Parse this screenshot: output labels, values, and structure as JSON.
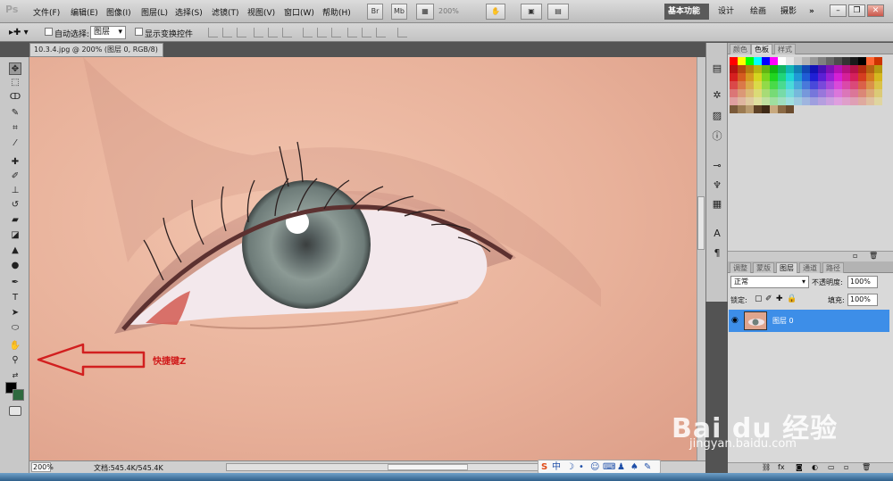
{
  "app": {
    "logo": "Ps"
  },
  "menu": [
    "文件(F)",
    "编辑(E)",
    "图像(I)",
    "图层(L)",
    "选择(S)",
    "滤镜(T)",
    "视图(V)",
    "窗口(W)",
    "帮助(H)"
  ],
  "menubar": {
    "bridge_btn": "Br",
    "minibridge_btn": "Mb",
    "zoom": "200%",
    "workspaces": [
      "基本功能",
      "设计",
      "绘画",
      "摄影"
    ],
    "more": "»"
  },
  "options": {
    "auto_select_label": "自动选择:",
    "auto_select_target": "图层",
    "show_transform_label": "显示变换控件"
  },
  "document": {
    "tab_title": "10.3.4.jpg @ 200% (图层 0, RGB/8) *",
    "status_zoom": "200%",
    "status_doc": "文档:545.4K/545.4K"
  },
  "annotation": {
    "text": "快捷键Z",
    "color": "#d01a1a"
  },
  "swatches_panel": {
    "tabs": [
      "颜色",
      "色板",
      "样式"
    ],
    "active": 1
  },
  "layers_panel": {
    "tabs": [
      "调整",
      "蒙版",
      "图层",
      "通道",
      "路径"
    ],
    "active": 2,
    "blend_mode": "正常",
    "opacity_label": "不透明度:",
    "opacity": "100%",
    "lock_label": "锁定:",
    "fill_label": "填充:",
    "fill": "100%",
    "layer_name": "图层 0",
    "selected_color": "#3d8ee8"
  },
  "ime": {
    "label": "中"
  },
  "watermark": {
    "logo": "Bai du 经验",
    "url": "jingyan.baidu.com"
  },
  "colors": {
    "menubar": "#cfcfcf",
    "app_bg": "#535353",
    "skin": "#e9b49c",
    "iris": "#7d8f8a"
  }
}
